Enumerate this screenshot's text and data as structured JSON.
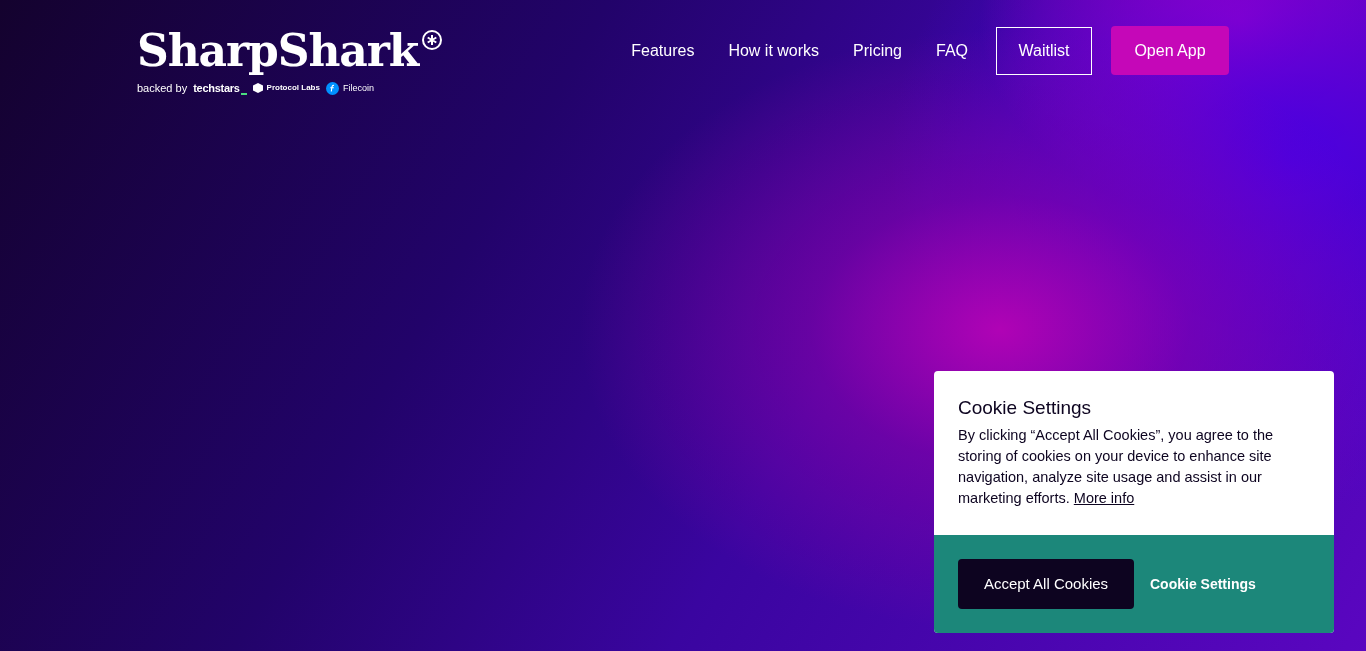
{
  "header": {
    "logo": "SharpShark",
    "backed_by": "backed by",
    "backers": [
      {
        "name": "techstars",
        "kind": "wordmark"
      },
      {
        "name": "Protocol Labs",
        "kind": "cube"
      },
      {
        "name": "Filecoin",
        "kind": "coin"
      }
    ]
  },
  "nav": [
    {
      "label": "Features",
      "kind": "link"
    },
    {
      "label": "How it works",
      "kind": "link"
    },
    {
      "label": "Pricing",
      "kind": "link"
    },
    {
      "label": "FAQ",
      "kind": "link"
    },
    {
      "label": "Waitlist",
      "kind": "outline"
    },
    {
      "label": "Open App",
      "kind": "filled"
    }
  ],
  "cookie_banner": {
    "title": "Cookie Settings",
    "text": "By clicking “Accept All Cookies”, you agree to the storing of cookies on your device to enhance site navigation, analyze site usage and assist in our marketing efforts.",
    "link": "More info",
    "accept_button": "Accept All Cookies",
    "settings_button": "Cookie Settings"
  }
}
